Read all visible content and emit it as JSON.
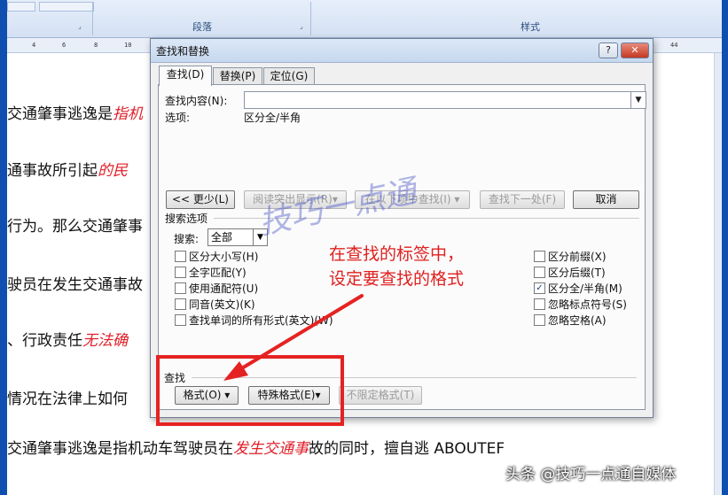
{
  "ribbon": {
    "group_paragraph": "段落",
    "group_styles": "样式"
  },
  "ruler": {
    "marks": [
      "4",
      "6",
      "8",
      "10"
    ],
    "right_mark": "44"
  },
  "document": {
    "lines": [
      {
        "plain": "交通肇事逃逸是",
        "red": "指机"
      },
      {
        "plain": "通事故所引起",
        "red": "的民"
      },
      {
        "plain": "行为。那么交通肇事",
        "red": ""
      },
      {
        "plain": "驶员在发生交通事故",
        "red": ""
      },
      {
        "plain": "、行政责任",
        "red": "无法确"
      },
      {
        "plain": "情况在法律上如何",
        "red": ""
      },
      {
        "plain": "交通肇事逃逸是指机动车驾驶员在",
        "red": "发生交通事",
        "plain2": "故的同时，擅自逃 ABOUTEF"
      }
    ]
  },
  "dialog": {
    "title": "查找和替换",
    "help_label": "?",
    "close_label": "✕",
    "tabs": [
      "查找(D)",
      "替换(P)",
      "定位(G)"
    ],
    "find_what_label": "查找内容(N):",
    "find_what_value": "",
    "options_label": "选项:",
    "options_value": "区分全/半角",
    "buttons": {
      "less": "<< 更少(L)",
      "reading_highlight": "阅读突出显示(R)▾",
      "find_in": "在以下项中查找(I) ▾",
      "find_next": "查找下一处(F)",
      "cancel": "取消"
    },
    "search_options_title": "搜索选项",
    "search_label": "搜索:",
    "search_value": "全部",
    "left_options": [
      {
        "label": "区分大小写(H)",
        "checked": false
      },
      {
        "label": "全字匹配(Y)",
        "checked": false
      },
      {
        "label": "使用通配符(U)",
        "checked": false
      },
      {
        "label": "同音(英文)(K)",
        "checked": false
      },
      {
        "label": "查找单词的所有形式(英文)(W)",
        "checked": false
      }
    ],
    "right_options": [
      {
        "label": "区分前缀(X)",
        "checked": false
      },
      {
        "label": "区分后缀(T)",
        "checked": false
      },
      {
        "label": "区分全/半角(M)",
        "checked": true
      },
      {
        "label": "忽略标点符号(S)",
        "checked": false
      },
      {
        "label": "忽略空格(A)",
        "checked": false
      }
    ],
    "find_section_title": "查找",
    "format_button": "格式(O) ▾",
    "special_button": "特殊格式(E)▾",
    "no_format_button": "不限定格式(T)"
  },
  "annotation": {
    "line1": "在查找的标签中，",
    "line2": "设定要查找的格式",
    "color": "#e02020"
  },
  "watermark_text": "技巧一点通",
  "credit": "头条 @技巧一点通自媒体"
}
